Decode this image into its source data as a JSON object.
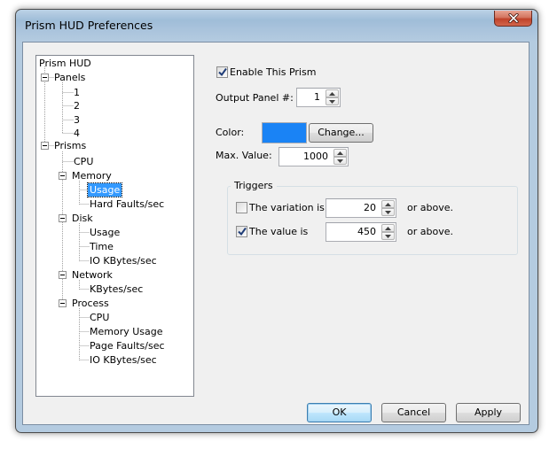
{
  "window": {
    "title": "Prism HUD Preferences"
  },
  "tree": {
    "nodes": [
      {
        "label": "Prism HUD"
      },
      {
        "label": "Panels"
      },
      {
        "label": "1"
      },
      {
        "label": "2"
      },
      {
        "label": "3"
      },
      {
        "label": "4"
      },
      {
        "label": "Prisms"
      },
      {
        "label": "CPU"
      },
      {
        "label": "Memory"
      },
      {
        "label": "Usage",
        "selected": true
      },
      {
        "label": "Hard Faults/sec"
      },
      {
        "label": "Disk"
      },
      {
        "label": "Usage"
      },
      {
        "label": "Time"
      },
      {
        "label": "IO KBytes/sec"
      },
      {
        "label": "Network"
      },
      {
        "label": "KBytes/sec"
      },
      {
        "label": "Process"
      },
      {
        "label": "CPU"
      },
      {
        "label": "Memory Usage"
      },
      {
        "label": "Page Faults/sec"
      },
      {
        "label": "IO KBytes/sec"
      }
    ]
  },
  "settings": {
    "enable_label": "Enable This Prism",
    "enable_checked": true,
    "output_panel_label": "Output Panel #:",
    "output_panel_value": "1",
    "color_label": "Color:",
    "color_value": "#1a83f5",
    "change_button": "Change...",
    "max_value_label": "Max. Value:",
    "max_value": "1000"
  },
  "triggers": {
    "group_label": "Triggers",
    "variation_label": "The variation is",
    "variation_checked": false,
    "variation_value": "20",
    "variation_suffix": "or above.",
    "value_label": "The value is",
    "value_checked": true,
    "value_value": "450",
    "value_suffix": "or above."
  },
  "buttons": {
    "ok": "OK",
    "cancel": "Cancel",
    "apply": "Apply"
  },
  "icons": {
    "close": "close-icon",
    "check": "check-icon",
    "spin_up": "chevron-up-icon",
    "spin_down": "chevron-down-icon"
  }
}
